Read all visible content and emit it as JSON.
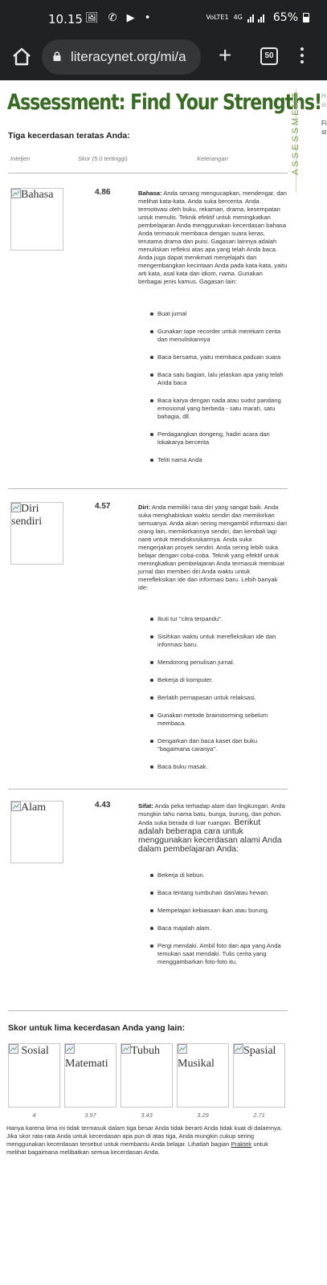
{
  "status_bar": {
    "time": "10.15",
    "notif_icons": "🖼 ✆ ▶ •",
    "network_label": "VoLTE1",
    "network_type": "4G",
    "battery": "65%"
  },
  "browser": {
    "url": "literacynet.org/mi/a",
    "tab_count": "50"
  },
  "page": {
    "title": "Assessment: Find Your Strengths!",
    "side_label": "ASSESSMENT",
    "side_peek_1": "H\nsi",
    "side_peek_2": "Fi\nst",
    "top_three_heading": "Tiga kecerdasan teratas Anda:",
    "columns": {
      "intel": "Inteljen",
      "score": "Skor (5.0 tertinggi)",
      "desc": "Keterangan"
    },
    "top": [
      {
        "img_alt": "Bahasa",
        "score": "4.86",
        "desc_label": "Bahasa:",
        "desc_text": " Anda senang mengucapkan, mendengar, dan melihat kata-kata. Anda suka bercerita. Anda termotivasi oleh buku, rekaman, drama, kesempatan untuk menulis. Teknik efektif untuk meningkatkan pembelajaran Anda menggunakan kecerdasan bahasa Anda termasuk membaca dengan suara keras, terutama drama dan puisi. Gagasan lainnya adalah menuliskan refleksi atas apa yang telah Anda baca. Anda juga dapat menikmati menjelajahi dan mengembangkan kecintaan Anda pada kata-kata, yaitu arti kata, asal kata dan idiom, nama. Gunakan berbagai jenis kamus. Gagasan lain:",
        "tips": [
          "Buat jurnal",
          "Gunakan tape recorder untuk merekam cerita dan menuliskannya",
          "Baca bersama, yaitu membaca paduan suara",
          "Baca satu bagian, lalu jelaskan apa yang telah Anda baca",
          "Baca karya dengan nada atau sudut pandang emosional yang berbeda - satu marah, satu bahagia, dll.",
          "Perdagangkan dongeng, hadiri acara dan lokakarya bercerita",
          "Teliti nama Anda"
        ]
      },
      {
        "img_alt": "Diri sendiri",
        "score": "4.57",
        "desc_label": "Diri:",
        "desc_text": " Anda memiliki rasa diri yang sangat baik. Anda suka menghabiskan waktu sendiri dan memikirkan semuanya. Anda akan sering mengambil informasi dari orang lain, memikirkannya sendiri, dan kembali lagi nanti untuk mendiskusikannya. Anda suka mengerjakan proyek sendiri. Anda sering lebih suka belajar dengan coba-coba. Teknik yang efektif untuk meningkatkan pembelajaran Anda termasuk membuat jurnal dan memberi diri Anda waktu untuk merefleksikan ide dan informasi baru. Lebih banyak ide:",
        "tips": [
          "Ikuti tur \"citra terpandu\".",
          "Sisihkan waktu untuk merefleksikan ide dan informasi baru.",
          "Mendorong penulisan jurnal.",
          "Bekerja di komputer.",
          "Berlatih pernapasan untuk relaksasi.",
          "Gunakan metode brainstorming sebelum membaca.",
          "Dengarkan dan baca kaset dan buku \"bagaimana caranya\".",
          "Baca buku masak."
        ]
      },
      {
        "img_alt": "Alam",
        "score": "4.43",
        "desc_label": "Sifat:",
        "desc_text": " Anda peka terhadap alam dan lingkungan. Anda mungkin tahu nama batu, bunga, burung, dan pohon. Anda suka berada di luar ruangan.",
        "desc_big": " Berikut adalah beberapa cara untuk menggunakan kecerdasan alami Anda dalam pembelajaran Anda:",
        "tips": [
          "Bekerja di kebun.",
          "Baca tentang tumbuhan dan/atau hewan.",
          "Mempelajari kebiasaan ikan atau burung.",
          "Baca majalah alam.",
          "Pergi mendaki. Ambil foto dari apa yang Anda temukan saat mendaki. Tulis cerita yang menggambarkan foto-foto itu."
        ]
      }
    ],
    "other_heading": "Skor untuk lima kecerdasan Anda yang lain:",
    "others": [
      {
        "img_alt": "Sosial",
        "score": "4"
      },
      {
        "img_alt": "Matemati",
        "score": "3.57"
      },
      {
        "img_alt": "Tubuh",
        "score": "3.43"
      },
      {
        "img_alt": "Musikal",
        "score": "3.29"
      },
      {
        "img_alt": "Spasial",
        "score": "2.71"
      }
    ],
    "footer_before": "Hanya karena lima ini tidak termasuk dalam tiga besar Anda tidak berarti Anda tidak kuat di dalamnya. Jika skor rata-rata Anda untuk kecerdasan apa pun di atas tiga, Anda mungkin cukup sering menggunakan kecerdasan tersebut untuk membantu Anda belajar. Lihatlah bagian ",
    "footer_link": "Praktek",
    "footer_after": " untuk melihat bagaimana melibatkan semua kecerdasan Anda."
  }
}
